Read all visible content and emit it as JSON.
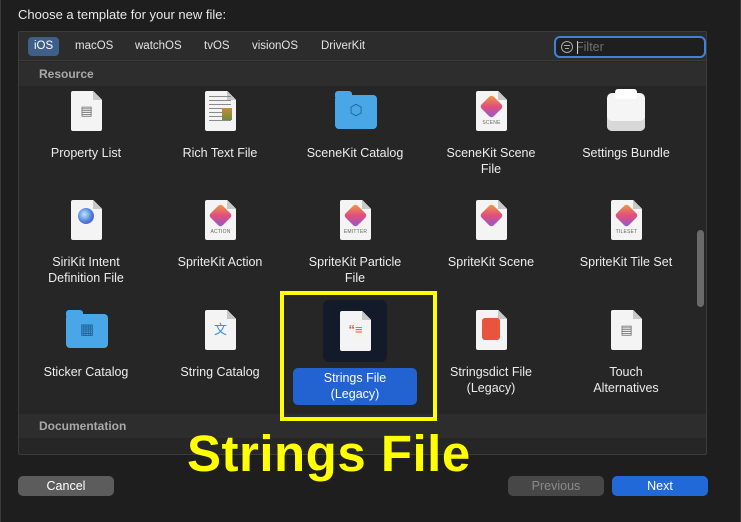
{
  "dialog": {
    "prompt": "Choose a template for your new file:"
  },
  "platforms": [
    {
      "label": "iOS",
      "active": true
    },
    {
      "label": "macOS",
      "active": false
    },
    {
      "label": "watchOS",
      "active": false
    },
    {
      "label": "tvOS",
      "active": false
    },
    {
      "label": "visionOS",
      "active": false
    },
    {
      "label": "DriverKit",
      "active": false
    }
  ],
  "filter": {
    "placeholder": "Filter",
    "value": ""
  },
  "sections": [
    {
      "title": "Resource"
    },
    {
      "title": "Documentation"
    }
  ],
  "templates": [
    {
      "label": "Property List",
      "icon": "property-list-icon",
      "selected": false
    },
    {
      "label": "Rich Text File",
      "icon": "rich-text-icon",
      "selected": false
    },
    {
      "label": "SceneKit Catalog",
      "icon": "scenekit-folder-icon",
      "selected": false
    },
    {
      "label": "SceneKit Scene\nFile",
      "icon": "scenekit-scene-icon",
      "icon_caption": "SCENE",
      "selected": false
    },
    {
      "label": "Settings Bundle",
      "icon": "settings-bundle-icon",
      "selected": false
    },
    {
      "label": "SiriKit Intent\nDefinition File",
      "icon": "sirikit-intent-icon",
      "selected": false
    },
    {
      "label": "SpriteKit Action",
      "icon": "spritekit-action-icon",
      "icon_caption": "ACTION",
      "selected": false
    },
    {
      "label": "SpriteKit Particle\nFile",
      "icon": "spritekit-emitter-icon",
      "icon_caption": "EMITTER",
      "selected": false
    },
    {
      "label": "SpriteKit Scene",
      "icon": "spritekit-scene-icon",
      "selected": false
    },
    {
      "label": "SpriteKit Tile Set",
      "icon": "spritekit-tileset-icon",
      "icon_caption": "TILESET",
      "selected": false
    },
    {
      "label": "Sticker Catalog",
      "icon": "sticker-catalog-icon",
      "selected": false
    },
    {
      "label": "String Catalog",
      "icon": "string-catalog-icon",
      "selected": false
    },
    {
      "label": "Strings File\n(Legacy)",
      "icon": "strings-file-icon",
      "selected": true
    },
    {
      "label": "Stringsdict File\n(Legacy)",
      "icon": "stringsdict-file-icon",
      "selected": false
    },
    {
      "label": "Touch\nAlternatives",
      "icon": "touch-alternatives-icon",
      "selected": false
    }
  ],
  "annotation": {
    "text": "Strings File",
    "color": "#ffff00"
  },
  "buttons": {
    "cancel": "Cancel",
    "previous": "Previous",
    "next": "Next"
  },
  "colors": {
    "accent": "#2169d8",
    "selection": "#2362d1",
    "background": "#1e1e1e"
  }
}
